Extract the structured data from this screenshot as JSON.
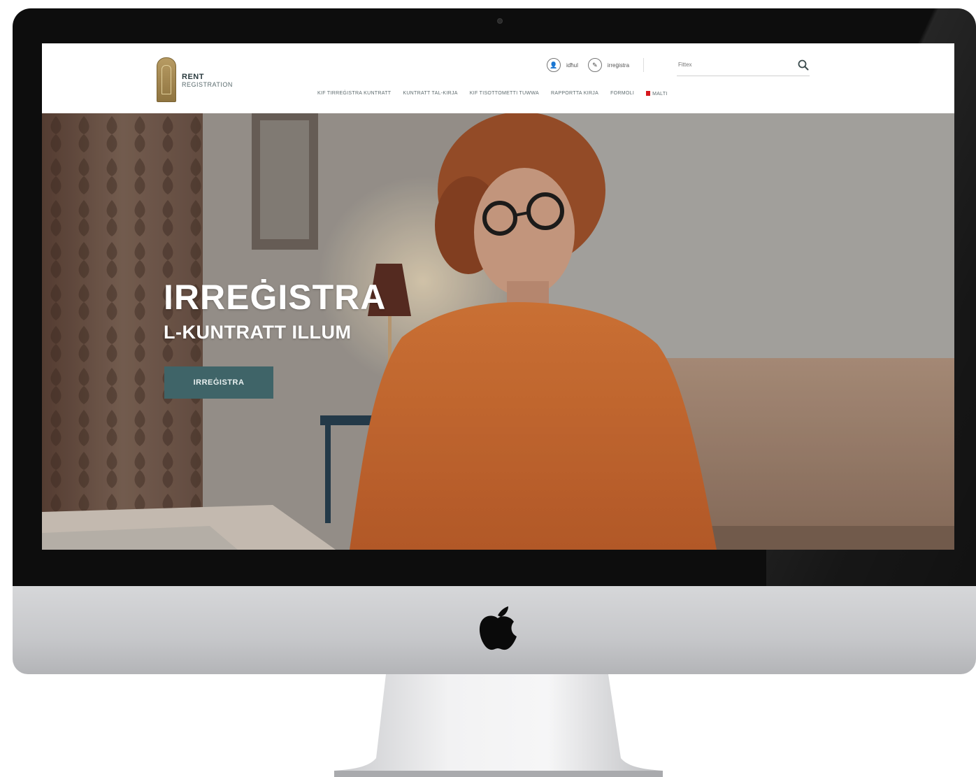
{
  "site": {
    "logo_rent": "RENT",
    "logo_registration": "REGISTRATION",
    "utility": {
      "login_label": "idħul",
      "register_label": "irreġistra"
    },
    "search_placeholder": "Fittex",
    "nav": [
      "KIF TIRREĠISTRA KUNTRATT",
      "KUNTRATT TAL-KIRJA",
      "KIF TISOTTOMETTI TUWWA",
      "RAPPORTTA KIRJA",
      "FORMOLI",
      "MALTI"
    ]
  },
  "hero": {
    "title": "IRREĠISTRA",
    "subtitle": "L-KUNTRATT ILLUM",
    "cta_label": "IRREĠISTRA"
  },
  "colors": {
    "cta_bg": "#3f6468",
    "sweater": "#d9702f",
    "flag": "#d6171d"
  },
  "icons": [
    "search-icon",
    "login-icon",
    "register-icon",
    "apple-logo",
    "camera"
  ]
}
